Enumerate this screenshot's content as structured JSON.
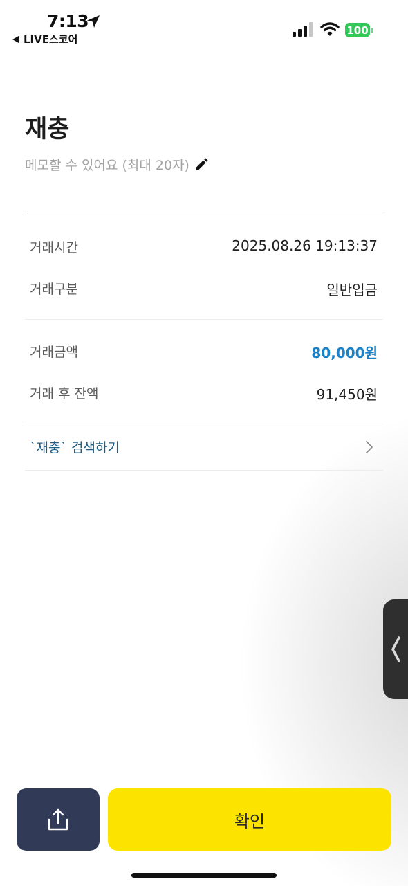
{
  "status_bar": {
    "time": "7:13",
    "back_app": "LIVE스코어",
    "battery": "100"
  },
  "header": {
    "title": "재충",
    "memo_placeholder": "메모할 수 있어요 (최대 20자)"
  },
  "details": {
    "time_label": "거래시간",
    "time_value": "2025.08.26 19:13:37",
    "type_label": "거래구분",
    "type_value": "일반입금",
    "amount_label": "거래금액",
    "amount_value": "80,000원",
    "balance_label": "거래 후 잔액",
    "balance_value": "91,450원"
  },
  "search_link": "`재충` 검색하기",
  "buttons": {
    "confirm": "확인"
  },
  "icons": {
    "status_location": "location-arrow-icon",
    "status_signal": "cellular-signal-icon",
    "status_wifi": "wifi-icon",
    "memo_edit": "pencil-icon",
    "search_chevron": "chevron-right-icon",
    "side_handle": "chevron-left-icon",
    "share": "share-icon"
  },
  "colors": {
    "amount": "#1a82c8",
    "link": "#1f5f86",
    "confirm_button": "#fde400",
    "share_button": "#313a57",
    "battery": "#34c759"
  }
}
